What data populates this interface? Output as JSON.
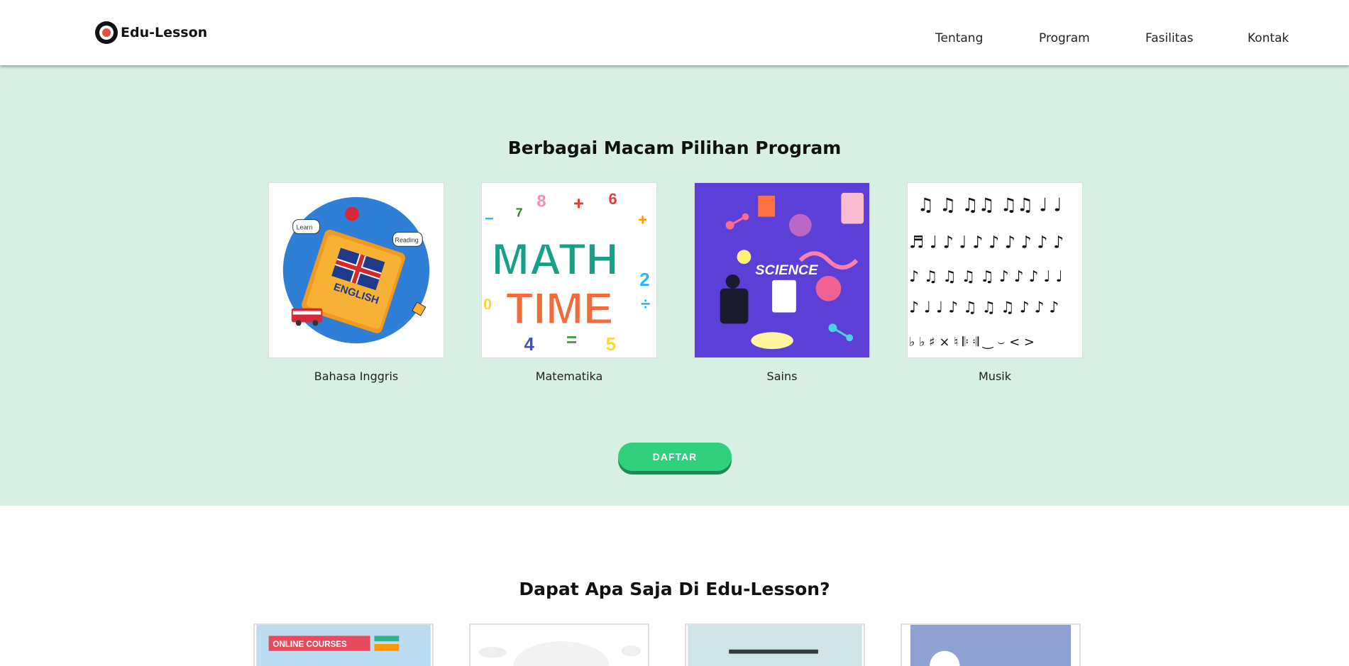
{
  "brand": {
    "name": "Edu-Lesson",
    "logo_icon": "logo-circle-icon"
  },
  "nav": {
    "items": [
      {
        "label": "Tentang"
      },
      {
        "label": "Program"
      },
      {
        "label": "Fasilitas"
      },
      {
        "label": "Kontak"
      }
    ]
  },
  "program_section": {
    "title": "Berbagai Macam Pilihan Program",
    "background": "#d8f0e3",
    "cards": [
      {
        "label": "Bahasa Inggris",
        "image_text": [
          "ENGLISH",
          "Learn",
          "Reading"
        ]
      },
      {
        "label": "Matematika",
        "image_text": [
          "MATH",
          "TIME"
        ]
      },
      {
        "label": "Sains",
        "image_text": [
          "SCIENCE"
        ]
      },
      {
        "label": "Musik"
      }
    ],
    "cta_label": "DAFTAR",
    "cta_color": "#31d07c"
  },
  "features_section": {
    "title": "Dapat Apa Saja Di Edu-Lesson?",
    "cards": [
      {
        "image_text": [
          "ONLINE COURSES"
        ]
      },
      {},
      {},
      {}
    ]
  }
}
